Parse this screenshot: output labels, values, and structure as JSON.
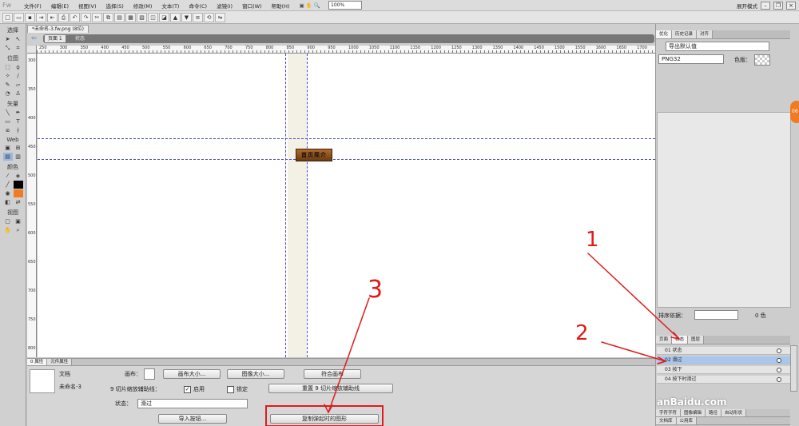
{
  "app": {
    "logo": "Fw"
  },
  "menu": [
    "文件(F)",
    "编辑(E)",
    "视图(V)",
    "选择(S)",
    "修改(M)",
    "文本(T)",
    "命令(C)",
    "滤镜(I)",
    "窗口(W)",
    "帮助(H)"
  ],
  "workspace_mode": "展开模式",
  "zoom": "100%",
  "tools": {
    "select": "选择",
    "bitmap": "位图",
    "vector": "矢量",
    "web": "Web",
    "colors": "颜色",
    "view": "视图"
  },
  "document": {
    "tab_label": "*未命名-3.fw.png (8位)",
    "page_label": "页面 1",
    "state_label": "状态"
  },
  "rulers": {
    "h": [
      "250",
      "300",
      "350",
      "400",
      "450",
      "500",
      "550",
      "600",
      "650",
      "700",
      "750",
      "800",
      "850",
      "900",
      "950",
      "1000",
      "1050",
      "1100",
      "1150",
      "1200",
      "1250",
      "1300",
      "1350",
      "1400",
      "1450",
      "1500",
      "1550",
      "1600",
      "1650",
      "1700"
    ],
    "v": [
      "300",
      "350",
      "400",
      "450",
      "500",
      "550",
      "600",
      "650",
      "700",
      "750",
      "800"
    ]
  },
  "banner_text": "首页简介",
  "right_panel": {
    "tabs": [
      "优化",
      "历史记录",
      "对齐"
    ],
    "export_preset": "导出默认值",
    "format": "PNG32",
    "matte_label": "色版：",
    "sort_label": "排序依据：",
    "color_count": "0 色",
    "layer_tabs": [
      "页面",
      "状态",
      "图层"
    ],
    "layers": [
      {
        "name": "01 状态",
        "selected": false
      },
      {
        "name": "02 滑过",
        "selected": true
      },
      {
        "name": "03 按下",
        "selected": false
      },
      {
        "name": "04 按下时滑过",
        "selected": false
      }
    ],
    "bottom_tabs_row1": [
      "字符字符",
      "图像编辑",
      "路径",
      "自动形状"
    ],
    "bottom_tabs_row2": [
      "文档库",
      "公用库"
    ],
    "watermark": "anBaidu.com"
  },
  "properties": {
    "tabs": [
      "0 属性",
      "元件属性"
    ],
    "doc_label": "文档",
    "doc_name": "未命名-3",
    "canvas_label": "画布：",
    "canvas_size_btn": "画布大小...",
    "image_size_btn": "图像大小...",
    "fit_canvas_btn": "符合画布",
    "nine_slice_label": "9 切片缩放辅助线：",
    "enable_label": "启用",
    "lock_label": "锁定",
    "reset_btn": "重置 9 切片缩放辅助线",
    "state_label": "状态：",
    "state_value": "滑过",
    "import_btn": "导入按钮...",
    "copy_btn": "复制弹起时的图形"
  },
  "annotations": [
    "1",
    "2",
    "3"
  ],
  "colors": {
    "annotation": "#e01b1b",
    "guide": "#4a4acb",
    "badge": "#f07b22"
  }
}
